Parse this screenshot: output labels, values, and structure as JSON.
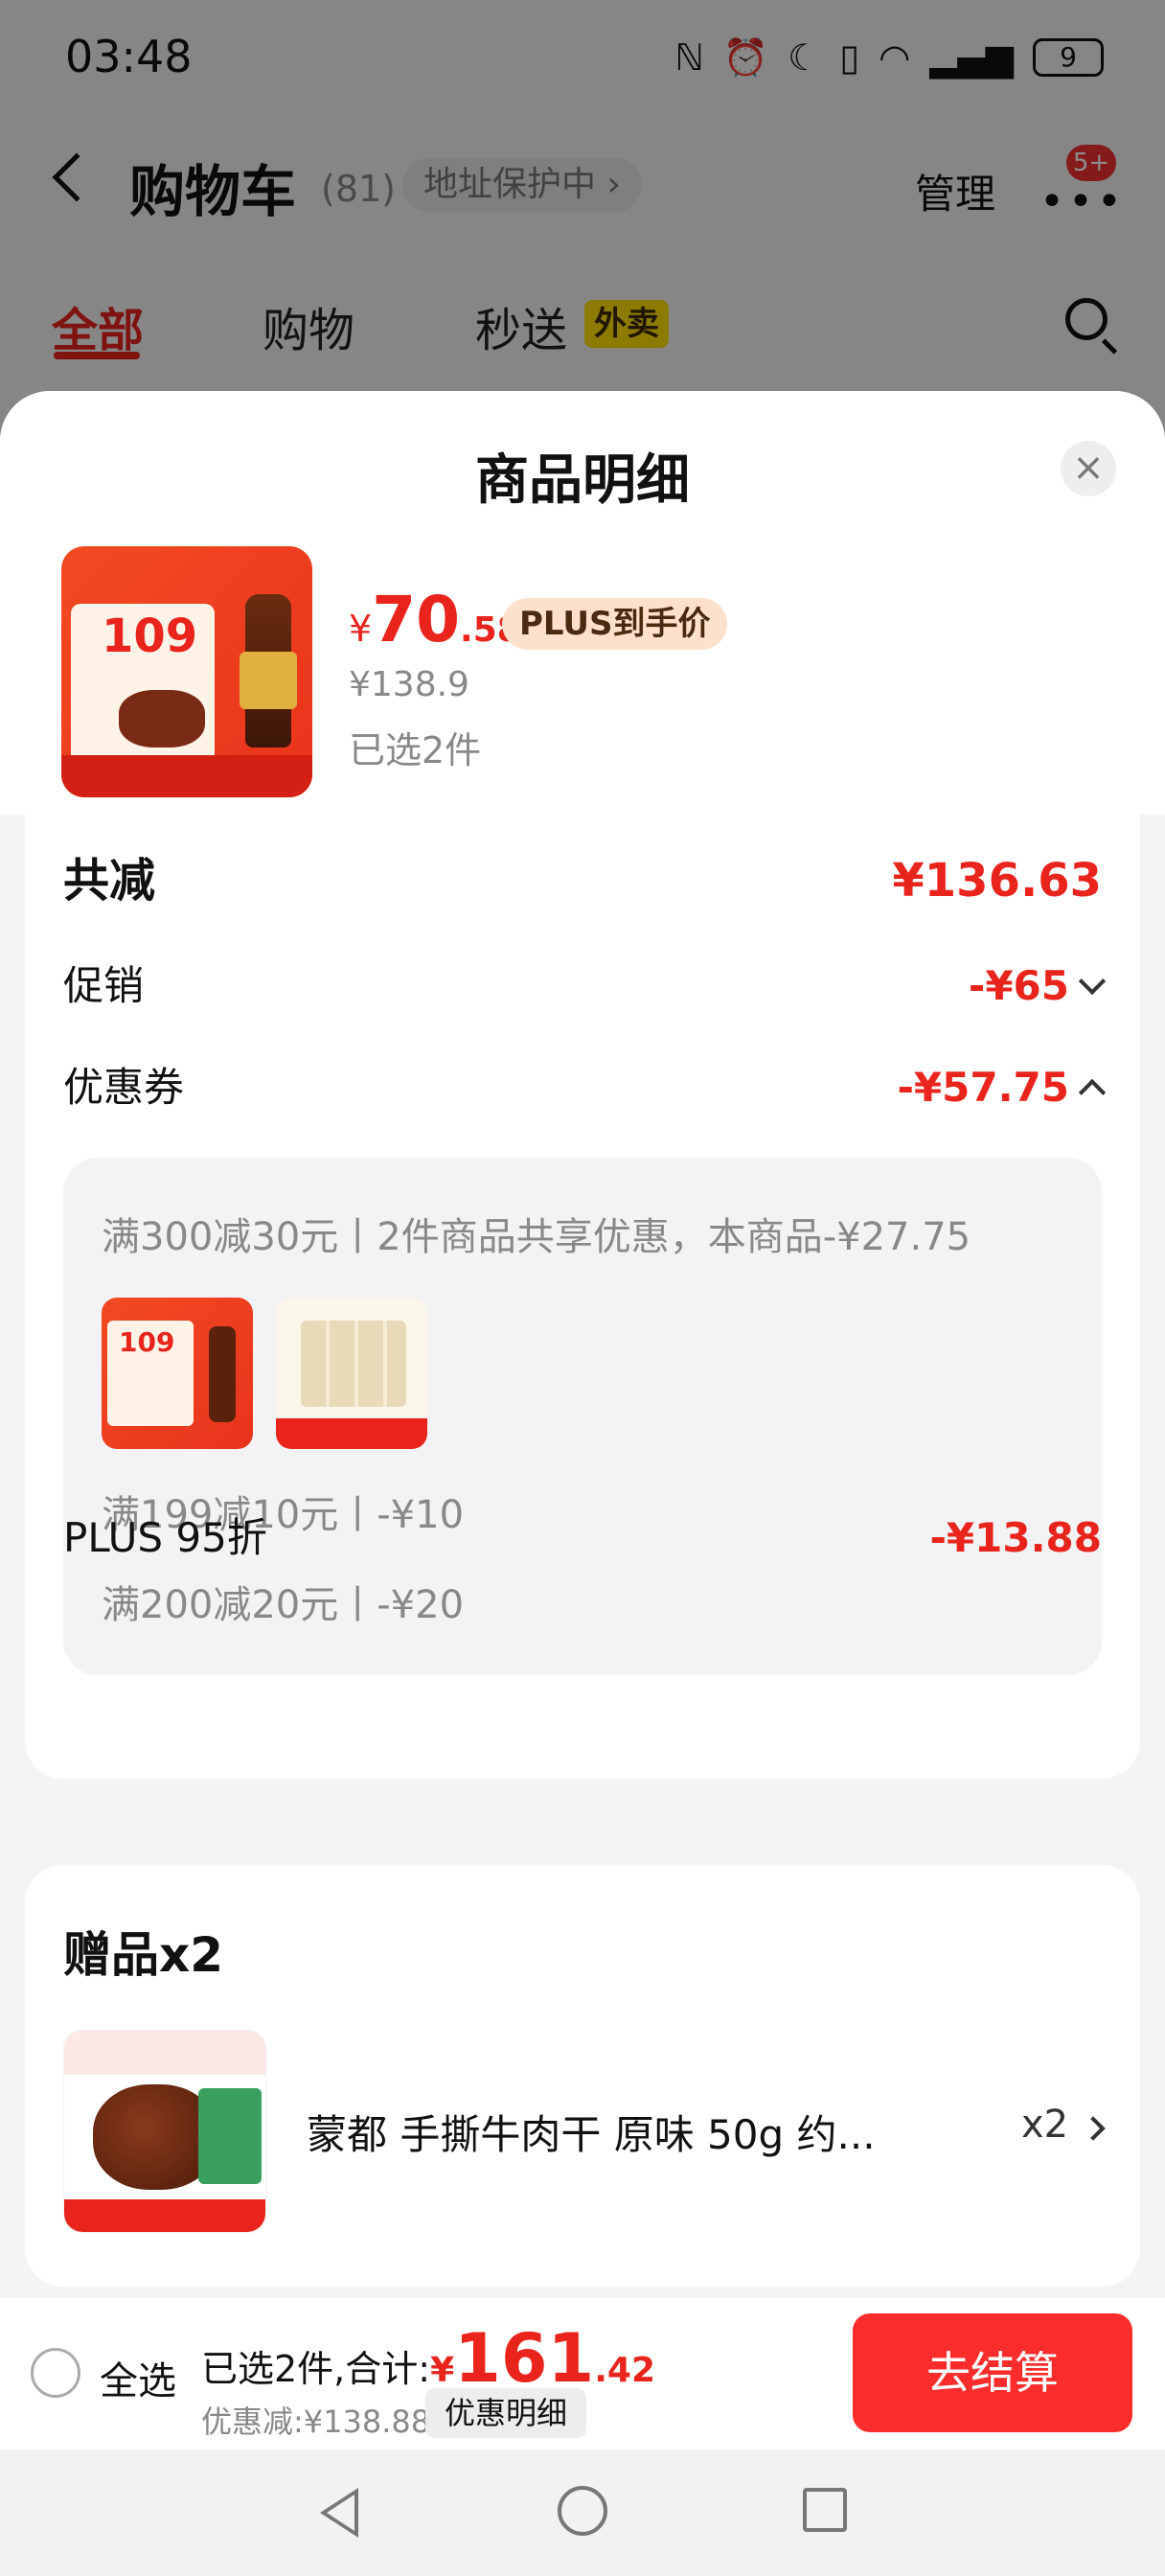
{
  "status_bar": {
    "time": "03:48",
    "icons": [
      "nfc-icon",
      "alarm-icon",
      "moon-icon",
      "vibrate-icon",
      "wifi-icon",
      "signal-icon"
    ],
    "battery": "9"
  },
  "cart_header": {
    "title": "购物车",
    "count": "(81)",
    "address_protect": "地址保护中 ›",
    "manage": "管理",
    "more_badge": "5+"
  },
  "tabs": [
    {
      "label": "全部",
      "active": true
    },
    {
      "label": "购物",
      "active": false
    },
    {
      "label": "秒送",
      "active": false
    }
  ],
  "tab_badge": "外卖",
  "sheet": {
    "title": "商品明细",
    "close": "×"
  },
  "product": {
    "image_text": "109",
    "price_yen": "¥",
    "price_int": "70",
    "price_dec": ".58",
    "plus_tag": "PLUS到手价",
    "original_price": "¥138.9",
    "selected": "已选2件"
  },
  "discounts": {
    "total_label": "共减",
    "total_value": "¥136.63",
    "promo_label": "促销",
    "promo_value": "-¥65",
    "coupon_label": "优惠券",
    "coupon_value": "-¥57.75",
    "coupon_details": [
      "满300减30元丨2件商品共享优惠，本商品-¥27.75",
      "满199减10元丨-¥10",
      "满200减20元丨-¥20"
    ],
    "thumb_text": "109",
    "plus_label": "PLUS 95折",
    "plus_value": "-¥13.88"
  },
  "gift": {
    "title": "赠品x2",
    "name": "蒙都 手撕牛肉干 原味 50g 约...",
    "qty": "x2"
  },
  "checkout": {
    "select_all": "全选",
    "total_label": "已选2件,合计:",
    "total_yen": "¥",
    "total_int": "161",
    "total_dec": ".42",
    "discount_text": "优惠减:¥138.88",
    "discount_button": "优惠明细",
    "checkout_button": "去结算"
  },
  "colors": {
    "accent_red": "#e8241c",
    "checkout_red": "#fa2c2c",
    "plus_tag_bg": "#fde1cc",
    "waimai_yellow": "#ffe000"
  }
}
